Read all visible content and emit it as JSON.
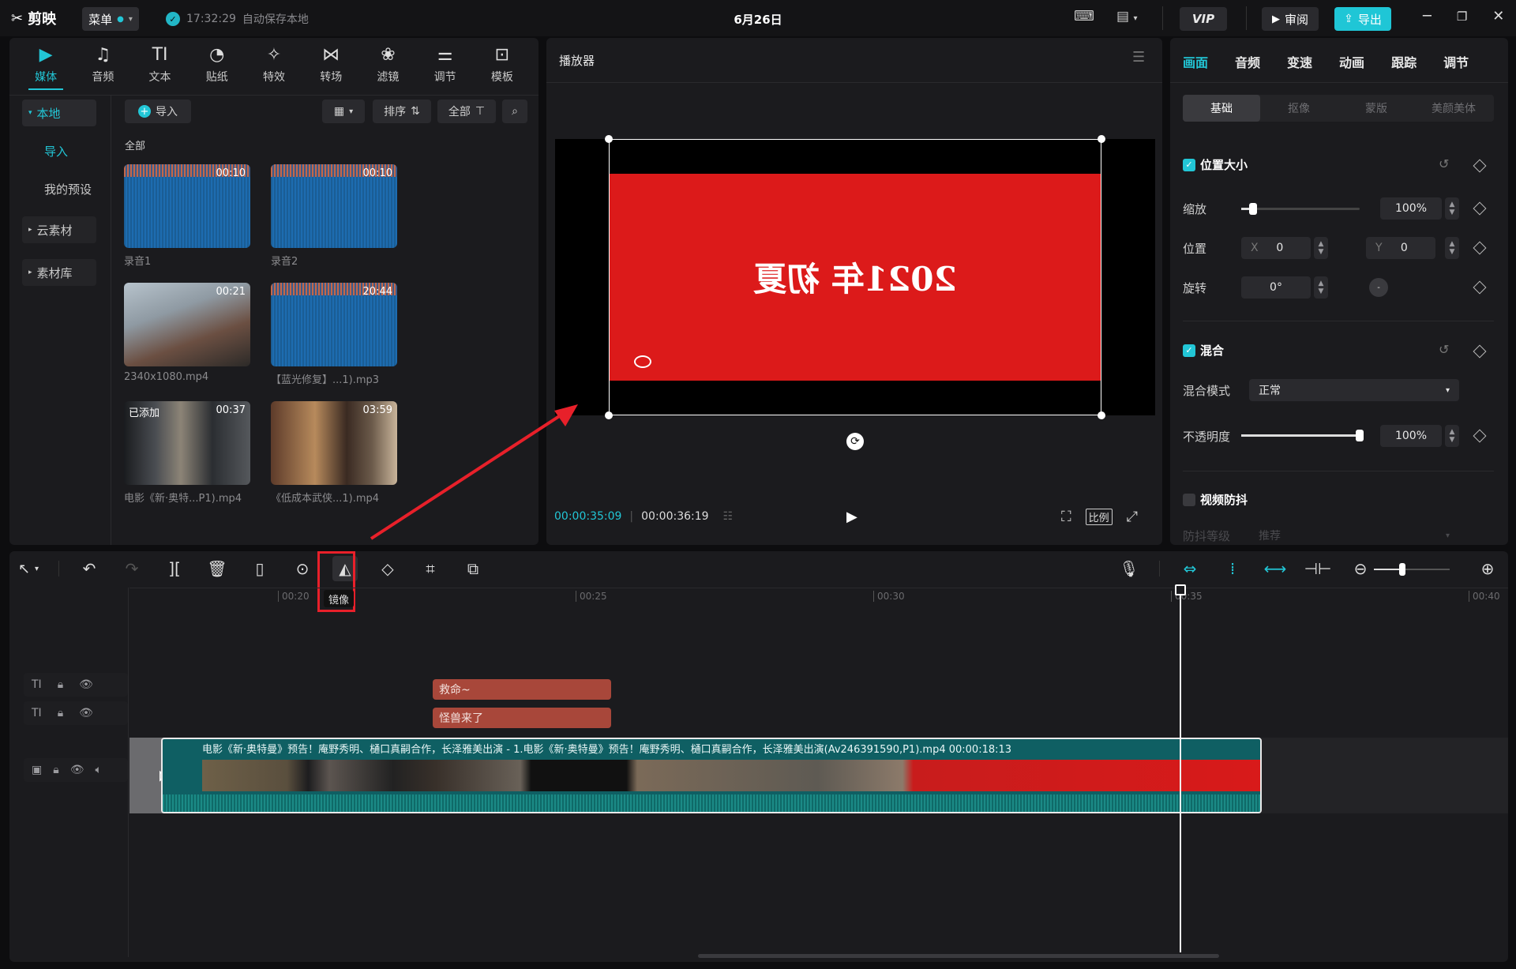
{
  "app": {
    "name": "剪映",
    "menu_label": "菜单",
    "save_time": "17:32:29",
    "save_text": "自动保存本地",
    "project_title": "6月26日"
  },
  "topbar": {
    "vip": "VIP",
    "review": "审阅",
    "export": "导出"
  },
  "media_tabs": [
    {
      "label": "媒体",
      "icon": "media-icon"
    },
    {
      "label": "音频",
      "icon": "audio-icon"
    },
    {
      "label": "文本",
      "icon": "text-icon"
    },
    {
      "label": "贴纸",
      "icon": "sticker-icon"
    },
    {
      "label": "特效",
      "icon": "effects-icon"
    },
    {
      "label": "转场",
      "icon": "transition-icon"
    },
    {
      "label": "滤镜",
      "icon": "filter-icon"
    },
    {
      "label": "调节",
      "icon": "adjust-icon"
    },
    {
      "label": "模板",
      "icon": "template-icon"
    }
  ],
  "sidebar": {
    "local": "本地",
    "import": "导入",
    "presets": "我的预设",
    "cloud": "云素材",
    "library": "素材库"
  },
  "media_toolbar": {
    "import": "导入",
    "sort": "排序",
    "all": "全部",
    "section": "全部"
  },
  "media_items": [
    {
      "name": "录音1",
      "duration": "00:10",
      "type": "audio",
      "tag": ""
    },
    {
      "name": "录音2",
      "duration": "00:10",
      "type": "audio",
      "tag": ""
    },
    {
      "name": "2340x1080.mp4",
      "duration": "00:21",
      "type": "video-dragon",
      "tag": ""
    },
    {
      "name": "【蓝光修复】...1).mp3",
      "duration": "20:44",
      "type": "audio",
      "tag": ""
    },
    {
      "name": "电影《新·奥特...P1).mp4",
      "duration": "00:37",
      "type": "video-man",
      "tag": "已添加"
    },
    {
      "name": "《低成本武侠...1).mp4",
      "duration": "03:59",
      "type": "video-fight",
      "tag": ""
    }
  ],
  "player": {
    "title": "播放器",
    "frame_text": "2021年 初夏",
    "current_time": "00:00:35:09",
    "total_time": "00:00:36:19",
    "ratio": "比例"
  },
  "right_tabs": [
    "画面",
    "音频",
    "变速",
    "动画",
    "跟踪",
    "调节"
  ],
  "sub_tabs": [
    "基础",
    "抠像",
    "蒙版",
    "美颜美体"
  ],
  "props": {
    "position_size": "位置大小",
    "scale_label": "缩放",
    "scale_value": "100%",
    "scale_level": 0.1,
    "position_label": "位置",
    "x_label": "X",
    "x_value": "0",
    "y_label": "Y",
    "y_value": "0",
    "rotate_label": "旋转",
    "rotate_value": "0°",
    "blend": "混合",
    "blend_mode_label": "混合模式",
    "blend_mode_value": "正常",
    "opacity_label": "不透明度",
    "opacity_value": "100%",
    "opacity_level": 1.0,
    "stabilize": "视频防抖",
    "stabilize_level_label": "防抖等级",
    "stabilize_level_value": "推荐"
  },
  "timeline": {
    "tooltip": "镜像",
    "ruler": [
      "00:20",
      "00:25",
      "00:30",
      "00:35",
      "00:40"
    ],
    "text_clips": [
      "救命~",
      "怪兽来了"
    ],
    "video_clip_label": "电影《新·奥特曼》预告！庵野秀明、樋口真嗣合作，长泽雅美出演 - 1.电影《新·奥特曼》预告！庵野秀明、樋口真嗣合作，长泽雅美出演(Av246391590,P1).mp4   00:00:18:13"
  },
  "colors": {
    "accent": "#22c6d6",
    "red_frame": "#dc1a1a",
    "annotation": "#e8202a",
    "text_clip": "#a8473a",
    "video_track": "#0f5f63"
  }
}
